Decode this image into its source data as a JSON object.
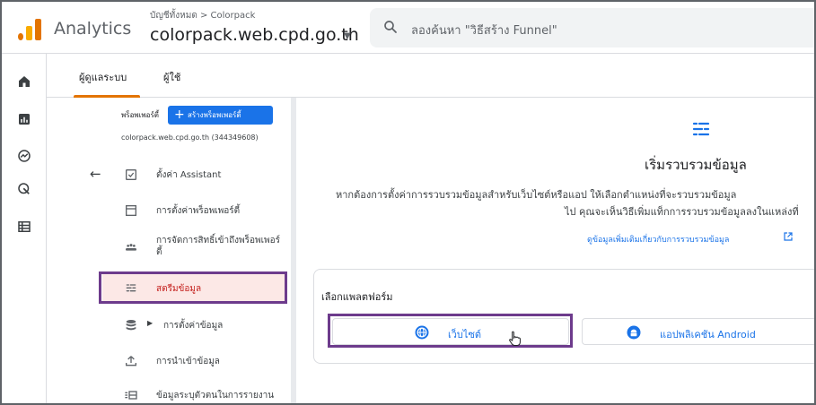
{
  "header": {
    "app_title": "Analytics",
    "account_path": "บัญชีทั้งหมด > Colorpack",
    "property_name": "colorpack.web.cpd.go.th",
    "search_placeholder": "ลองค้นหา \"วิธีสร้าง Funnel\""
  },
  "rail": {
    "icons": [
      "home-icon",
      "reports-icon",
      "explore-icon",
      "advertising-icon",
      "configure-icon"
    ]
  },
  "tabs": [
    {
      "label": "ผู้ดูแลระบบ",
      "active": true
    },
    {
      "label": "ผู้ใช้",
      "active": false
    }
  ],
  "property_column": {
    "heading": "พร็อพเพอร์ตี้",
    "create_button": "สร้างพร็อพเพอร์ตี้",
    "property_sub": "colorpack.web.cpd.go.th (344349608)",
    "items": [
      {
        "label": "ตั้งค่า Assistant",
        "icon": "checkbox-icon"
      },
      {
        "label": "การตั้งค่าพร็อพเพอร์ตี้",
        "icon": "window-icon"
      },
      {
        "label": "การจัดการสิทธิ์เข้าถึงพร็อพเพอร์ตี้",
        "icon": "people-icon"
      },
      {
        "label": "สตรีมข้อมูล",
        "icon": "stream-icon",
        "selected": true
      },
      {
        "label": "การตั้งค่าข้อมูล",
        "icon": "database-icon"
      },
      {
        "label": "การนำเข้าข้อมูล",
        "icon": "upload-icon"
      },
      {
        "label": "ข้อมูลระบุตัวตนในการรายงาน",
        "icon": "reporting-identity-icon"
      }
    ]
  },
  "main": {
    "title": "เริ่มรวบรวมข้อมูล",
    "description_line1": "หากต้องการตั้งค่าการรวบรวมข้อมูลสำหรับเว็บไซต์หรือแอป ให้เลือกตำแหน่งที่จะรวบรวมข้อมูล",
    "description_line2": "ไป คุณจะเห็นวิธีเพิ่มแท็กการรวบรวมข้อมูลลงในแหล่งที่",
    "learn_more": "ดูข้อมูลเพิ่มเติมเกี่ยวกับการรวบรวมข้อมูล",
    "platform_label": "เลือกแพลตฟอร์ม",
    "platforms": [
      {
        "label": "เว็บไซต์",
        "icon": "globe-icon"
      },
      {
        "label": "แอปพลิเคชัน Android",
        "icon": "android-icon"
      }
    ]
  },
  "colors": {
    "accent_blue": "#1a73e8",
    "analytics_orange": "#e37400",
    "highlight_purple": "#6d3b8c",
    "selected_red": "#c5221f"
  }
}
